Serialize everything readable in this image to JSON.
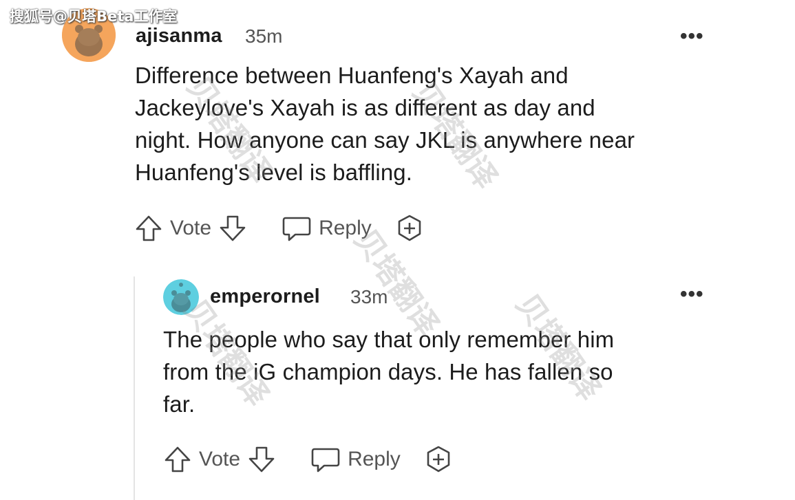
{
  "source_watermark": "搜狐号@贝塔Beta工作室",
  "overlay_watermark": "贝塔翻译",
  "comments": [
    {
      "username": "ajisanma",
      "time": "35m",
      "more": "•••",
      "body": [
        "Difference between Huanfeng's Xayah and",
        "Jackeylove's Xayah is as different as day and",
        "night. How anyone can say JKL is anywhere near",
        "Huanfeng's level is baffling."
      ],
      "vote_label": "Vote",
      "reply_label": "Reply",
      "avatar_color": "#f5a55c"
    },
    {
      "username": "emperornel",
      "time": "33m",
      "more": "•••",
      "body": [
        "The people who say that only remember him",
        "from the iG champion days. He has fallen so",
        "far."
      ],
      "vote_label": "Vote",
      "reply_label": "Reply",
      "avatar_color": "#5ecfe0"
    }
  ]
}
